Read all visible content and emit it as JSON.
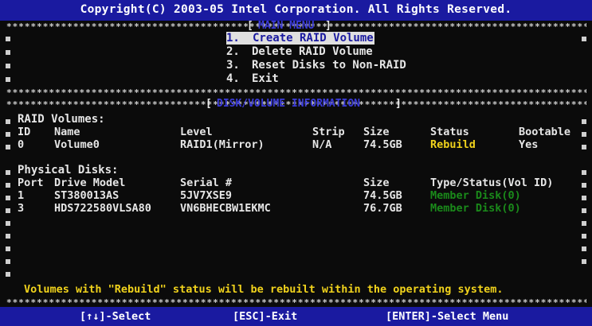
{
  "header": {
    "copyright": "Copyright(C) 2003-05 Intel Corporation.  All Rights Reserved."
  },
  "main_menu": {
    "title": "MAIN MENU",
    "items": [
      {
        "number": "1.",
        "label": "Create RAID Volume",
        "selected": true
      },
      {
        "number": "2.",
        "label": "Delete RAID Volume",
        "selected": false
      },
      {
        "number": "3.",
        "label": "Reset Disks to Non-RAID",
        "selected": false
      },
      {
        "number": "4.",
        "label": "Exit",
        "selected": false
      }
    ]
  },
  "info": {
    "title": "DISK/VOLUME INFORMATION",
    "raid_volumes": {
      "heading": "RAID Volumes:",
      "columns": {
        "id": "ID",
        "name": "Name",
        "level": "Level",
        "strip": "Strip",
        "size": "Size",
        "status": "Status",
        "bootable": "Bootable"
      },
      "rows": [
        {
          "id": "0",
          "name": "Volume0",
          "level": "RAID1(Mirror)",
          "strip": "N/A",
          "size": "74.5GB",
          "status": "Rebuild",
          "bootable": "Yes"
        }
      ]
    },
    "physical_disks": {
      "heading": "Physical Disks:",
      "columns": {
        "port": "Port",
        "model": "Drive Model",
        "serial": "Serial #",
        "size": "Size",
        "type": "Type/Status(Vol ID)"
      },
      "rows": [
        {
          "port": "1",
          "model": "ST380013AS",
          "serial": "5JV7XSE9",
          "size": "74.5GB",
          "type": "Member Disk(0)"
        },
        {
          "port": "3",
          "model": "HDS722580VLSA80",
          "serial": "VN6BHECBW1EKMC",
          "size": "76.7GB",
          "type": "Member Disk(0)"
        }
      ]
    },
    "message": "Volumes with \"Rebuild\" status will be rebuilt within the operating system."
  },
  "footer": {
    "select": "[↑↓]-Select",
    "exit": "[ESC]-Exit",
    "enter": "[ENTER]-Select Menu"
  },
  "colors": {
    "band": "#1a1aa0",
    "highlight_text": "#f0d21c",
    "member_disk": "#1a8a1a"
  }
}
